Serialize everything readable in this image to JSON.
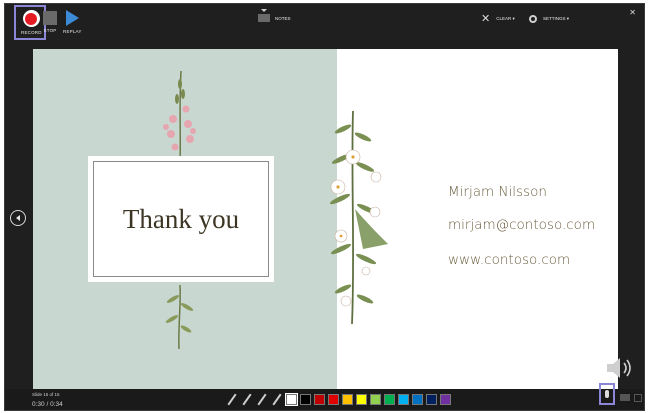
{
  "toolbar": {
    "record_label": "RECORD",
    "stop_label": "STOP",
    "replay_label": "REPLAY",
    "notes_label": "NOTES",
    "clear_label": "CLEAR ▾",
    "settings_label": "SETTINGS ▾",
    "close_glyph": "✕"
  },
  "slide": {
    "title": "Thank you",
    "name": "Mirjam Nilsson",
    "email": "mirjam@contoso.com",
    "website": "www.contoso.com"
  },
  "status": {
    "slide_info": "Slide 15 of 15",
    "timer": "0:30 / 0:34"
  },
  "ink_colors": [
    "#ffffff",
    "#000000",
    "#c00000",
    "#e00000",
    "#ffc000",
    "#ffff00",
    "#92d050",
    "#00b050",
    "#00b0f0",
    "#0070c0",
    "#002060",
    "#7030a0"
  ],
  "icons": {
    "record": "record-icon",
    "stop": "stop-icon",
    "replay": "replay-icon",
    "notes": "notes-icon",
    "clear": "clear-icon",
    "settings": "gear-icon",
    "prev": "previous-slide-icon",
    "mic": "microphone-icon",
    "speaker": "speaker-icon"
  },
  "colors": {
    "accent": "#8b86d6",
    "record_red": "#e51b23",
    "replay_blue": "#3d8ad6",
    "slide_left_bg": "#c9d7d1",
    "contact_text": "#6b5d3e"
  }
}
